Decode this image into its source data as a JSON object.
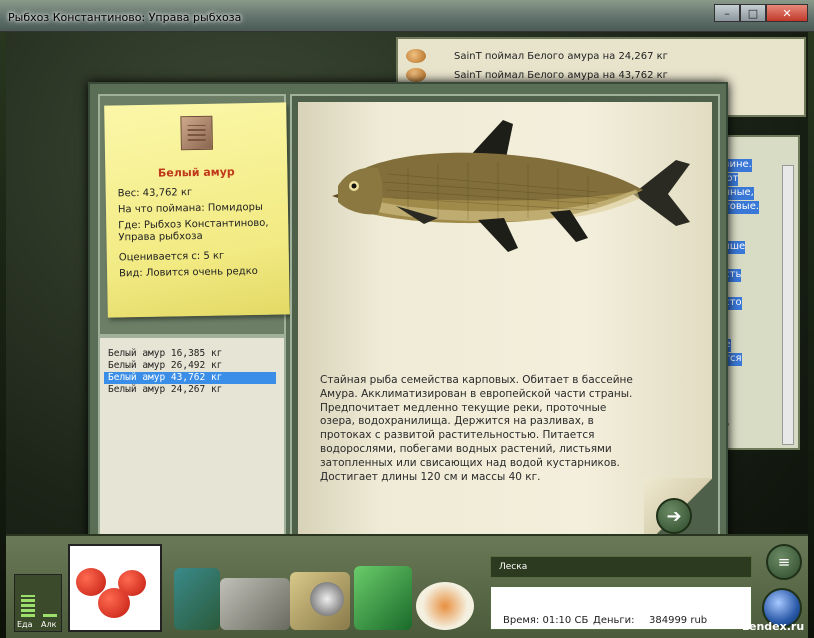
{
  "window": {
    "title": "Рыбхоз Константиново: Управа рыбхоза",
    "minimize": "–",
    "maximize": "□",
    "close": "✕"
  },
  "chat": {
    "lines": [
      "SainT поймал Белого амура на 24,267 кг",
      "SainT поймал Белого амура на 43,762 кг"
    ]
  },
  "side_panel": {
    "highlighted": [
      "азине.",
      "ают",
      "очные,",
      "нговые.",
      "я",
      "учше",
      "асть",
      "есто",
      "я",
      "ре",
      "ется"
    ],
    "green_text": "ку"
  },
  "fish_card": {
    "name": "Белый амур",
    "weight": "Вес: 43,762 кг",
    "bait": "На что поймана: Помидоры",
    "place_line1": "Где: Рыбхоз Константиново,",
    "place_line2": "Управа рыбхоза",
    "value": "Оценивается с: 5 кг",
    "rarity": "Вид: Ловится очень редко"
  },
  "catches": [
    "Белый амур 16,385 кг",
    "Белый амур 26,492 кг",
    "Белый амур 43,762 кг",
    "Белый амур 24,267 кг"
  ],
  "selected_catch_index": 2,
  "description": "Стайная рыба семейства карповых. Обитает в бассейне Амура. Акклиматизирован в европейской части страны. Предпочитает медленно текущие реки, проточные озера, водохранилища. Держится на разливах, в протоках с развитой растительностью. Питается водорослями, побегами водных растений, листьями затопленных или свисающих над водой кустарников. Достигает длины 120 см и массы 40 кг.",
  "next_icon": "➔",
  "hud": {
    "food_label": "Еда",
    "alc_label": "Алк",
    "food_level": 0.55,
    "alc_level": 0.1,
    "line_label": "Леска",
    "time": "Время: 01:10 СБ",
    "money_label": "Деньги:",
    "money_value": "384999 rub",
    "menu_icon": "≡"
  },
  "watermark": "Lendex.ru"
}
